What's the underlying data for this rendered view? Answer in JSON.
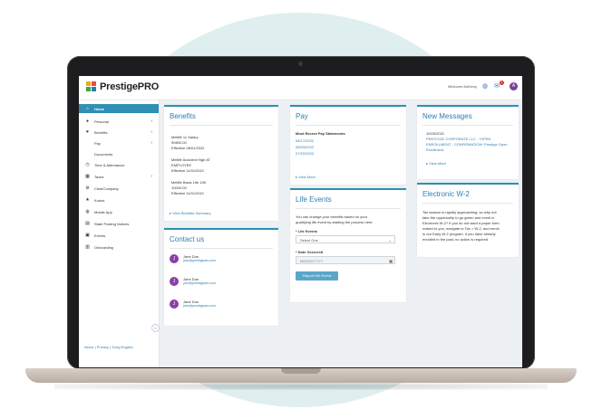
{
  "app": {
    "brand": "PrestigePRO",
    "welcome": "Welcome Anthony",
    "avatar_initial": "A",
    "mail_count": "1",
    "icons": {
      "help": "globe-icon",
      "mail": "mail-icon"
    }
  },
  "sidebar": {
    "items": [
      {
        "label": "Home",
        "icon": "home-icon",
        "chevron": ""
      },
      {
        "label": "Personal",
        "icon": "person-icon",
        "chevron": "›"
      },
      {
        "label": "Benefits",
        "icon": "heart-icon",
        "chevron": "›"
      },
      {
        "label": "Pay",
        "icon": "",
        "chevron": "›"
      },
      {
        "label": "Documents",
        "icon": "",
        "chevron": ""
      },
      {
        "label": "Time & Attendance",
        "icon": "clock-icon",
        "chevron": ""
      },
      {
        "label": "Taxes",
        "icon": "tax-icon",
        "chevron": "›"
      },
      {
        "label": "ClearCompany",
        "icon": "gear-icon",
        "chevron": ""
      },
      {
        "label": "Kudos",
        "icon": "star-icon",
        "chevron": ""
      },
      {
        "label": "Mobile App",
        "icon": "globe-icon",
        "chevron": ""
      },
      {
        "label": "State Posting Notices",
        "icon": "document-icon",
        "chevron": ""
      },
      {
        "label": "Events",
        "icon": "calendar-icon",
        "chevron": ""
      },
      {
        "label": "Onboarding",
        "icon": "onboarding-icon",
        "chevron": ""
      }
    ],
    "collapse": "«",
    "footer": "About  |  Privacy  |  Song English"
  },
  "benefits": {
    "title": "Benefits",
    "entries": [
      {
        "name": "Metlife 1x Salary",
        "value": "90800.00",
        "effective": "Effective 08/01/2022"
      },
      {
        "name": "Metlife Accident High AT",
        "value": "EMPLOYEE",
        "effective": "Effective 11/01/2021"
      },
      {
        "name": "Metlife Basic Life 10K",
        "value": "10000.00",
        "effective": "Effective 11/01/2021"
      }
    ],
    "link": "▸ View Benefits Summary"
  },
  "contact": {
    "title": "Contact us",
    "people": [
      {
        "initial": "J",
        "name": "Jane Doe",
        "email": "jdoe@prestigepeo.com"
      },
      {
        "initial": "J",
        "name": "Jane Doe",
        "email": "jdoe@prestigepeo.com"
      },
      {
        "initial": "J",
        "name": "Jane Doe",
        "email": "jdoe@prestigepeo.com"
      }
    ]
  },
  "pay": {
    "title": "Pay",
    "subtitle": "Most Recent Pay Statements",
    "statements": [
      "08/17/2022",
      "08/03/2022",
      "07/20/2022"
    ],
    "link": "▸ View More"
  },
  "life_events": {
    "title": "Life Events",
    "description_line1": "You can change your benefits based on your",
    "description_line2": "qualifying life event by starting the process here.",
    "life_events_label": "* Life Events",
    "select_value": "Select One",
    "date_label": "* Date Occurred",
    "date_placeholder": "MM/DD/YYYY",
    "button": "Report Life Event"
  },
  "messages": {
    "title": "New Messages",
    "date": "10/29/2021",
    "line1": "PRESTIGE CORPORATE LLC - *OPEN",
    "line2": "ENROLLMENT - CONFIRMATION* Prestige Open",
    "line3": "Enrollment",
    "link": "▸ View More"
  },
  "w2": {
    "title": "Electronic W-2",
    "lines": [
      "Tax season is rapidly approaching, so why not",
      "take the opportunity to go green and enroll in",
      "Electronic W-2? If you do not want a paper form",
      "mailed to you, navigate to Tax > W-2, and enroll",
      "in our Early W-2 program. If you have already",
      "enrolled in the past, no action is required."
    ]
  }
}
